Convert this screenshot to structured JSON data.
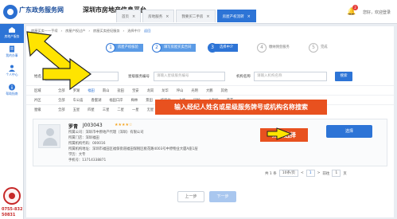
{
  "header": {
    "site_title": "广东政务服务网",
    "platform_title": "深圳市房地产信息平台",
    "tabs": [
      {
        "label": "首页",
        "active": false
      },
      {
        "label": "房地服务",
        "active": false
      },
      {
        "label": "我要买二手房",
        "active": false
      },
      {
        "label": "房屋产权流转",
        "active": true
      }
    ],
    "notification_count": "2",
    "user_name": "您好，欢迎登录"
  },
  "sidebar": {
    "items": [
      {
        "label": "房地产服务",
        "icon": "home-icon",
        "active": true
      },
      {
        "label": "我的办事",
        "icon": "document-icon",
        "active": false
      },
      {
        "label": "个人中心",
        "icon": "user-icon",
        "active": false
      },
      {
        "label": "帮助指南",
        "icon": "info-icon",
        "active": false
      }
    ],
    "hotline_lines": [
      "0755-832",
      "50831"
    ]
  },
  "breadcrumb": {
    "items": [
      "房屋买卖——手续",
      "房屋产权过户",
      "房屋买卖经纪服务",
      "选择中介"
    ],
    "back_label": "返回"
  },
  "steps": [
    {
      "num": "1",
      "label": "房屋产权核验",
      "state": "done"
    },
    {
      "num": "2",
      "label": "填写房屋买卖合同",
      "state": "done"
    },
    {
      "num": "3",
      "label": "选择中介",
      "state": "active"
    },
    {
      "num": "4",
      "label": "缴纳佣金服务",
      "state": "todo"
    },
    {
      "num": "5",
      "label": "完成",
      "state": "todo"
    }
  ],
  "filter": {
    "name_label": "姓名",
    "name_value": "罗青",
    "service_no_label": "星级服务编号",
    "service_no_placeholder": "请输入星级服务编号",
    "org_label": "机构名称",
    "org_placeholder": "请输入机构名称",
    "search_label": "搜索"
  },
  "regions": {
    "row1_label": "区域",
    "row1": [
      "全部",
      "罗湖",
      "福田",
      "南山",
      "盐田",
      "宝安",
      "龙岗",
      "龙华",
      "坪山",
      "光明",
      "大鹏",
      "其他"
    ],
    "row1_selected": "福田",
    "row2_label": "片区",
    "row2": [
      "全部",
      "车公庙",
      "香蜜湖",
      "福田口岸",
      "梅林",
      "景田",
      "华强北",
      "上步",
      "园岭",
      "八卦岭",
      "莲花"
    ],
    "row3_label": "星级",
    "row3": [
      "全部",
      "五星",
      "四星",
      "三星",
      "二星",
      "一星",
      "无星"
    ]
  },
  "annotations": {
    "search_hint": "输入经纪人姓名或星级服务牌号或机构名称搜索",
    "click_hint": "点击选择"
  },
  "agent": {
    "name": "罗青",
    "number": "J003043",
    "stars": "★★★★☆",
    "lines": [
      "所属公司：深圳市中原地产代理（深圳）有限公司",
      "所属门店：深圳福田",
      "所属机构代码：000016",
      "所属机构地址：深圳市福田区福保街道福田保税区桃花路4003号中原物业大厦A座1层",
      "学历：大专",
      "手机号：13714338871"
    ],
    "select_label": "选择"
  },
  "pagination": {
    "total": "共 1 条",
    "per_page": "10条/页",
    "prev": "<",
    "current": "1",
    "next": ">",
    "goto_label": "前往",
    "goto_value": "1",
    "page_suffix": "页"
  },
  "footer": {
    "prev_label": "上一步",
    "next_label": "下一步"
  },
  "colors": {
    "primary": "#2d74d6",
    "highlight": "#e8511f",
    "arrow": "#ffe400"
  }
}
